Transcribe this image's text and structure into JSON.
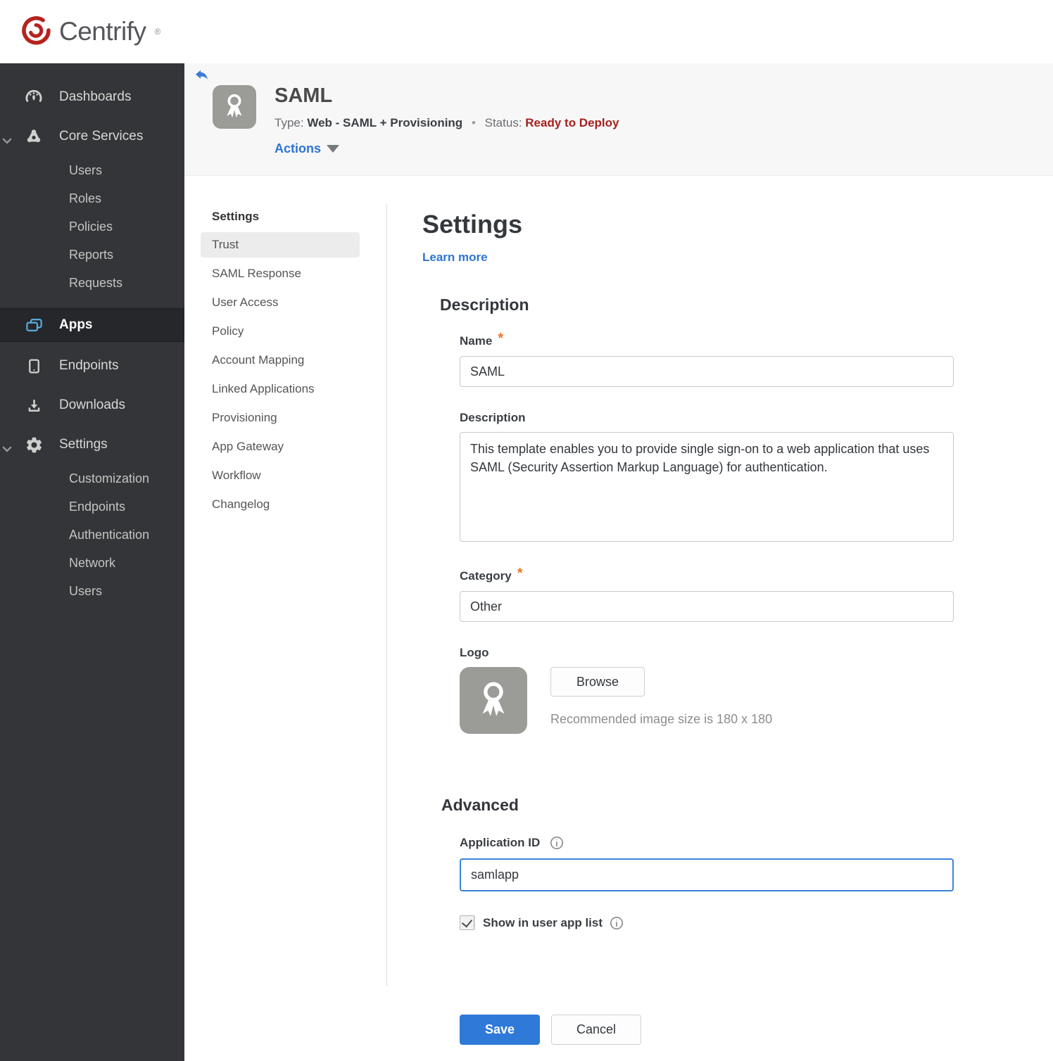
{
  "brand": {
    "name": "Centrify",
    "trademark": "®"
  },
  "sidebar": {
    "items": [
      {
        "label": "Dashboards",
        "icon": "gauge-icon"
      },
      {
        "label": "Core Services",
        "icon": "core-services-icon",
        "expanded": true,
        "children": [
          "Users",
          "Roles",
          "Policies",
          "Reports",
          "Requests"
        ]
      },
      {
        "label": "Apps",
        "icon": "apps-icon",
        "active": true
      },
      {
        "label": "Endpoints",
        "icon": "device-icon"
      },
      {
        "label": "Downloads",
        "icon": "download-icon"
      },
      {
        "label": "Settings",
        "icon": "gear-icon",
        "expanded": true,
        "children": [
          "Customization",
          "Endpoints",
          "Authentication",
          "Network",
          "Users"
        ]
      }
    ]
  },
  "header": {
    "title": "SAML",
    "type_label": "Type:",
    "type_value": "Web - SAML + Provisioning",
    "separator": "•",
    "status_label": "Status:",
    "status_value": "Ready to Deploy",
    "actions_label": "Actions",
    "app_icon": "award-ribbon-icon",
    "back_icon": "back-arrow-icon"
  },
  "subnav": {
    "heading": "Settings",
    "active_item": "Trust",
    "items": [
      "Trust",
      "SAML Response",
      "User Access",
      "Policy",
      "Account Mapping",
      "Linked Applications",
      "Provisioning",
      "App Gateway",
      "Workflow",
      "Changelog"
    ]
  },
  "main": {
    "title": "Settings",
    "learn_more": "Learn more",
    "description_section": {
      "heading": "Description",
      "name_label": "Name",
      "name_required": "*",
      "name_value": "SAML",
      "description_label": "Description",
      "description_value": "This template enables you to provide single sign-on to a web application that uses SAML (Security Assertion Markup Language) for authentication.",
      "category_label": "Category",
      "category_required": "*",
      "category_value": "Other",
      "logo_label": "Logo",
      "logo_icon": "award-ribbon-icon",
      "browse_label": "Browse",
      "logo_hint": "Recommended image size is 180 x 180"
    },
    "advanced_section": {
      "heading": "Advanced",
      "application_id_label": "Application ID",
      "application_id_value": "samlapp",
      "application_id_focused": true,
      "show_in_app_list_label": "Show in user app list",
      "show_in_app_list_checked": true
    },
    "buttons": {
      "save": "Save",
      "cancel": "Cancel"
    }
  },
  "colors": {
    "brand_red": "#b6231f",
    "accent_blue": "#2e74d2",
    "focus_blue": "#3b82d8",
    "save_blue": "#2f79d8",
    "status_red": "#a6201c",
    "required_orange": "#ee7623",
    "sidebar_bg": "#343538",
    "sidebar_active_icon": "#56aadf"
  }
}
